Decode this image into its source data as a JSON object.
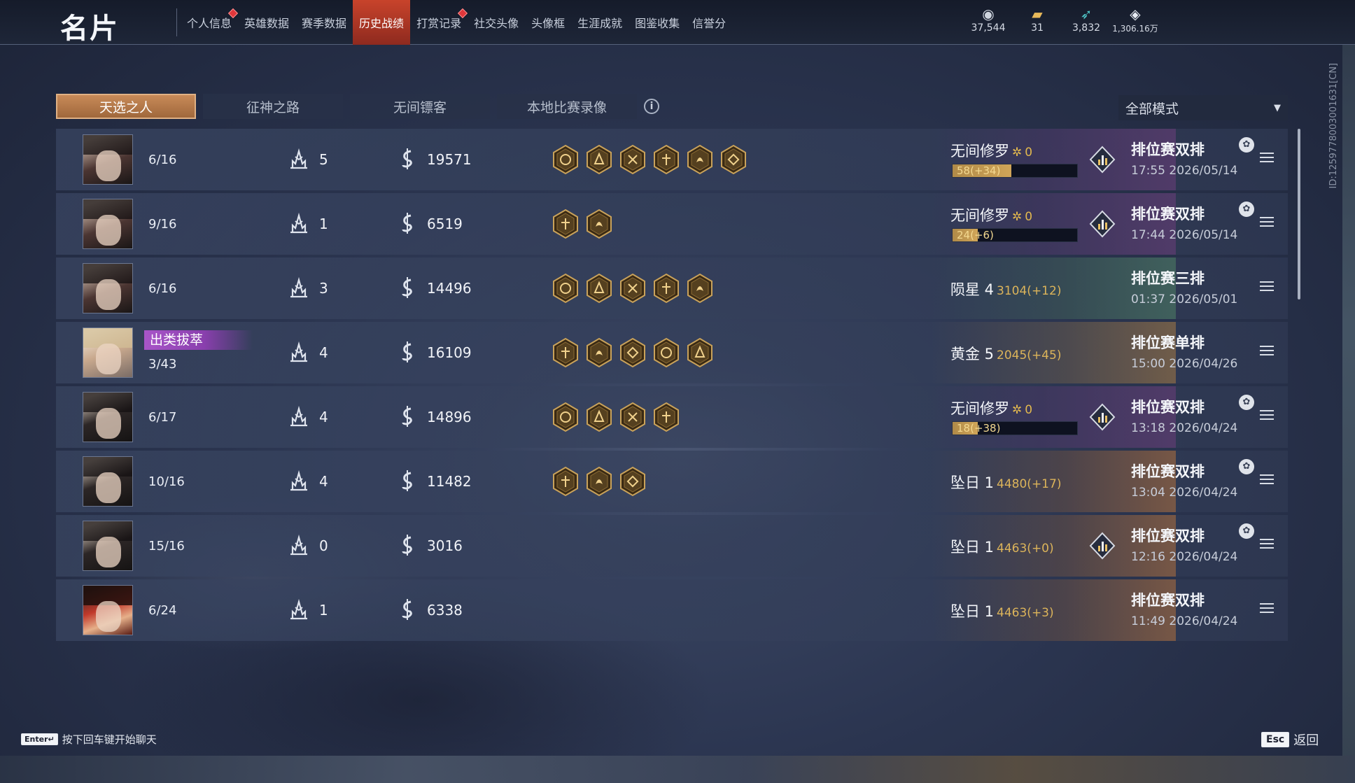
{
  "header": {
    "title": "名片",
    "nav": [
      {
        "label": "个人信息",
        "active": false,
        "dot": true
      },
      {
        "label": "英雄数据",
        "active": false,
        "dot": false
      },
      {
        "label": "赛季数据",
        "active": false,
        "dot": false
      },
      {
        "label": "历史战绩",
        "active": true,
        "dot": false
      },
      {
        "label": "打赏记录",
        "active": false,
        "dot": true
      },
      {
        "label": "社交头像",
        "active": false,
        "dot": false
      },
      {
        "label": "头像框",
        "active": false,
        "dot": false
      },
      {
        "label": "生涯成就",
        "active": false,
        "dot": false
      },
      {
        "label": "图鉴收集",
        "active": false,
        "dot": false
      },
      {
        "label": "信誉分",
        "active": false,
        "dot": false
      }
    ],
    "currencies": [
      {
        "icon": "coin-stack-icon",
        "value": "37,544"
      },
      {
        "icon": "ticket-icon",
        "value": "31"
      },
      {
        "icon": "feather-icon",
        "value": "3,832"
      },
      {
        "icon": "diamond-icon",
        "value": "1,306.16万"
      }
    ]
  },
  "filters": {
    "tabs": [
      {
        "label": "天选之人",
        "active": true
      },
      {
        "label": "征神之路",
        "active": false
      },
      {
        "label": "无间镖客",
        "active": false
      },
      {
        "label": "本地比赛录像",
        "active": false
      }
    ],
    "info_icon": "i",
    "mode_select": "全部模式"
  },
  "matches": [
    {
      "avatar": "v1",
      "placing": "6/16",
      "honor": "",
      "kills": "5",
      "damage": "19571",
      "badge_count": 6,
      "rank": {
        "name": "无间修罗",
        "star": "✲",
        "stars": "0",
        "score": "",
        "progress_text": "58(+34)",
        "progress": 0.47,
        "bg": "purple",
        "emblem": true
      },
      "mode": "排位赛双排",
      "time": "17:55  2026/05/14",
      "party": true
    },
    {
      "avatar": "v1",
      "placing": "9/16",
      "honor": "",
      "kills": "1",
      "damage": "6519",
      "badge_count": 2,
      "rank": {
        "name": "无间修罗",
        "star": "✲",
        "stars": "0",
        "score": "",
        "progress_text": "24(+6)",
        "progress": 0.2,
        "bg": "purple",
        "emblem": true
      },
      "mode": "排位赛双排",
      "time": "17:44  2026/05/14",
      "party": true
    },
    {
      "avatar": "v1",
      "placing": "6/16",
      "honor": "",
      "kills": "3",
      "damage": "14496",
      "badge_count": 5,
      "rank": {
        "name": "陨星 4",
        "star": "",
        "stars": "",
        "score": "3104(+12)",
        "progress_text": "",
        "progress": 0,
        "bg": "green",
        "emblem": false
      },
      "mode": "排位赛三排",
      "time": "01:37  2026/05/01",
      "party": false
    },
    {
      "avatar": "v2",
      "placing": "3/43",
      "honor": "出类拔萃",
      "kills": "4",
      "damage": "16109",
      "badge_count": 5,
      "rank": {
        "name": "黄金 5",
        "star": "",
        "stars": "",
        "score": "2045(+45)",
        "progress_text": "",
        "progress": 0,
        "bg": "gold",
        "emblem": false
      },
      "mode": "排位赛单排",
      "time": "15:00  2026/04/26",
      "party": false
    },
    {
      "avatar": "v3",
      "placing": "6/17",
      "honor": "",
      "kills": "4",
      "damage": "14896",
      "badge_count": 4,
      "rank": {
        "name": "无间修罗",
        "star": "✲",
        "stars": "0",
        "score": "",
        "progress_text": "18(+38)",
        "progress": 0.2,
        "bg": "purple",
        "emblem": true
      },
      "mode": "排位赛双排",
      "time": "13:18  2026/04/24",
      "party": true
    },
    {
      "avatar": "v3",
      "placing": "10/16",
      "honor": "",
      "kills": "4",
      "damage": "11482",
      "badge_count": 3,
      "rank": {
        "name": "坠日 1",
        "star": "",
        "stars": "",
        "score": "4480(+17)",
        "progress_text": "",
        "progress": 0,
        "bg": "bronze",
        "emblem": false
      },
      "mode": "排位赛双排",
      "time": "13:04  2026/04/24",
      "party": true
    },
    {
      "avatar": "v3",
      "placing": "15/16",
      "honor": "",
      "kills": "0",
      "damage": "3016",
      "badge_count": 0,
      "rank": {
        "name": "坠日 1",
        "star": "",
        "stars": "",
        "score": "4463(+0)",
        "progress_text": "",
        "progress": 0,
        "bg": "bronze",
        "emblem": true
      },
      "mode": "排位赛双排",
      "time": "12:16  2026/04/24",
      "party": true
    },
    {
      "avatar": "v4",
      "placing": "6/24",
      "honor": "",
      "kills": "1",
      "damage": "6338",
      "badge_count": 0,
      "rank": {
        "name": "坠日 1",
        "star": "",
        "stars": "",
        "score": "4463(+3)",
        "progress_text": "",
        "progress": 0,
        "bg": "bronze",
        "emblem": false
      },
      "mode": "排位赛双排",
      "time": "11:49  2026/04/24",
      "party": false
    }
  ],
  "side_id": "ID:1259778003001631[CN]",
  "footer": {
    "enter_key": "Enter↵",
    "chat_hint": "按下回车键开始聊天",
    "esc_key": "Esc",
    "back_label": "返回"
  },
  "colors": {
    "accent_active_tab": "#c8432b",
    "filter_active": "#c88a58",
    "honor_purple": "#a855c8",
    "rank_gold": "#e2b84e"
  }
}
